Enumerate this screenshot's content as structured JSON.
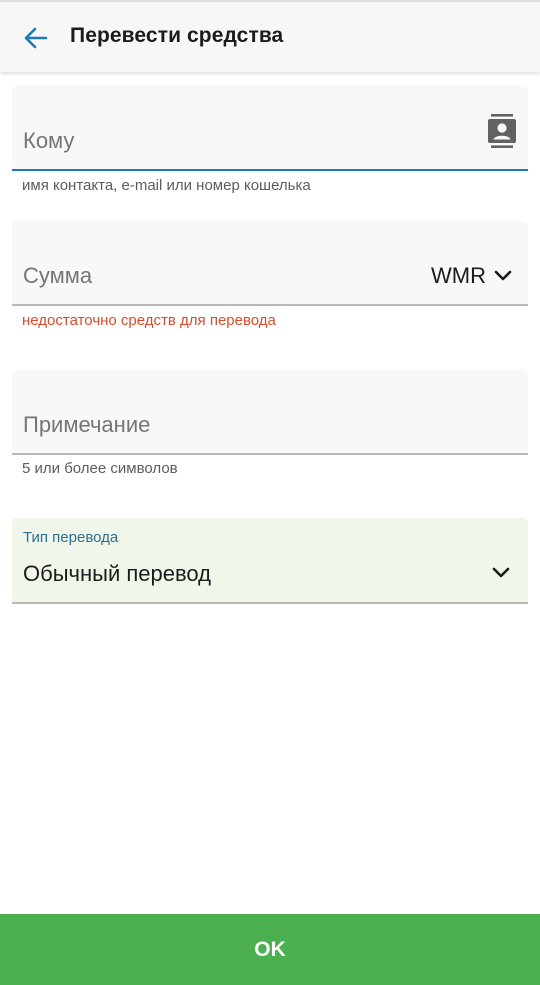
{
  "header": {
    "title": "Перевести средства"
  },
  "form": {
    "recipient": {
      "label": "Кому",
      "helper": "имя контакта, e-mail или номер кошелька"
    },
    "amount": {
      "label": "Сумма",
      "currency": "WMR",
      "error": "недостаточно средств для перевода"
    },
    "note": {
      "label": "Примечание",
      "helper": "5 или более символов"
    },
    "transfer_type": {
      "label": "Тип перевода",
      "value": "Обычный перевод"
    }
  },
  "actions": {
    "ok_label": "OK"
  },
  "colors": {
    "accent": "#1b7bb6",
    "error": "#d84b2b",
    "button": "#4caf50",
    "selected_field": "#f1f6ea"
  },
  "icons": [
    "arrow-back-icon",
    "contacts-icon",
    "chevron-down-icon"
  ]
}
